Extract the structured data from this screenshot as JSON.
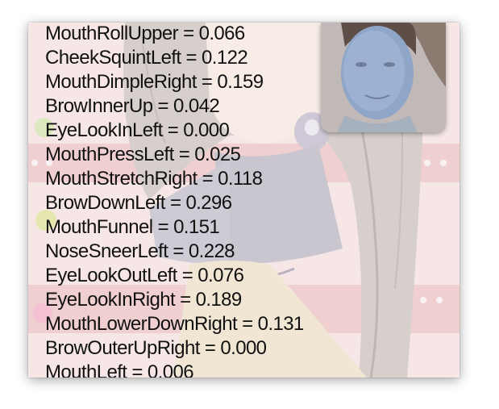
{
  "blendshapes": [
    {
      "name": "MouthRollUpper",
      "value": "0.066"
    },
    {
      "name": "CheekSquintLeft",
      "value": "0.122"
    },
    {
      "name": "MouthDimpleRight",
      "value": "0.159"
    },
    {
      "name": "BrowInnerUp",
      "value": "0.042"
    },
    {
      "name": "EyeLookInLeft",
      "value": "0.000"
    },
    {
      "name": "MouthPressLeft",
      "value": "0.025"
    },
    {
      "name": "MouthStretchRight",
      "value": "0.118"
    },
    {
      "name": "BrowDownLeft",
      "value": "0.296"
    },
    {
      "name": "MouthFunnel",
      "value": "0.151"
    },
    {
      "name": "NoseSneerLeft",
      "value": "0.228"
    },
    {
      "name": "EyeLookOutLeft",
      "value": "0.076"
    },
    {
      "name": "EyeLookInRight",
      "value": "0.189"
    },
    {
      "name": "MouthLowerDownRight",
      "value": "0.131"
    },
    {
      "name": "BrowOuterUpRight",
      "value": "0.000"
    },
    {
      "name": "MouthLeft",
      "value": "0.006"
    }
  ],
  "separator": " = ",
  "colors": {
    "background_pink": "#f6e7e6",
    "stripe_pink": "#efc9cb",
    "text": "#111111",
    "face_tint": "#8fa6c8"
  },
  "icons": {
    "avatar": "anime-character-illustration",
    "camera": "webcam-face-preview"
  }
}
